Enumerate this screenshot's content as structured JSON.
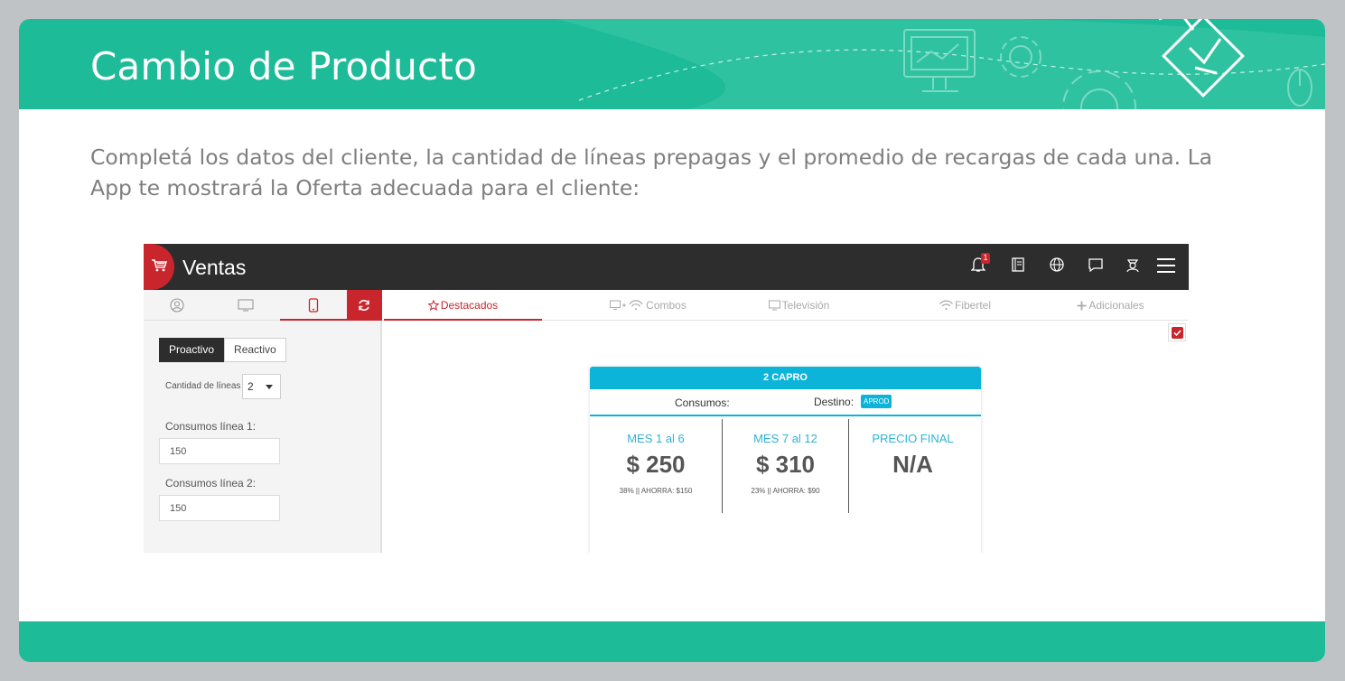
{
  "slide": {
    "title": "Cambio de Producto",
    "instructions": "Completá los datos del cliente, la cantidad de líneas prepagas y el promedio de recargas de cada una. La App te mostrará la Oferta adecuada para el cliente:"
  },
  "app": {
    "title": "Ventas",
    "notifications_count": "1",
    "top_icons": [
      "bell-icon",
      "book-icon",
      "globe-icon",
      "chat-icon",
      "user-agent-icon",
      "hamburger-menu-icon"
    ],
    "left_tabs": [
      "user-icon",
      "monitor-icon",
      "mobile-icon",
      "refresh-icon"
    ],
    "nav_tabs": [
      {
        "label": "Destacados",
        "icon": "star-icon"
      },
      {
        "label": "Combos",
        "icon": "monitor-wifi-icon"
      },
      {
        "label": "Televisión",
        "icon": "tv-icon"
      },
      {
        "label": "Fibertel",
        "icon": "wifi-icon"
      },
      {
        "label": "Adicionales",
        "icon": "plus-icon"
      }
    ],
    "mode": {
      "proactive": "Proactivo",
      "reactive": "Reactivo"
    },
    "lines": {
      "label": "Cantidad de líneas",
      "value": "2"
    },
    "fields": [
      {
        "label": "Consumos línea 1:",
        "value": "150"
      },
      {
        "label": "Consumos línea 2:",
        "value": "150"
      }
    ],
    "offer": {
      "title": "2 CAPRO",
      "consumos_label": "Consumos:",
      "destino_label": "Destino:",
      "destino_value": "APROD",
      "columns": [
        {
          "head": "MES 1 al 6",
          "price": "$ 250",
          "note": "38% || AHORRA: $150"
        },
        {
          "head": "MES 7 al 12",
          "price": "$ 310",
          "note": "23% || AHORRA: $90"
        },
        {
          "head": "PRECIO FINAL",
          "price": "N/A",
          "note": ""
        }
      ]
    }
  },
  "colors": {
    "teal": "#1dbb98",
    "brand_red": "#c8252c",
    "offer_blue": "#0bb4d8",
    "topbar": "#2d2d2d"
  }
}
